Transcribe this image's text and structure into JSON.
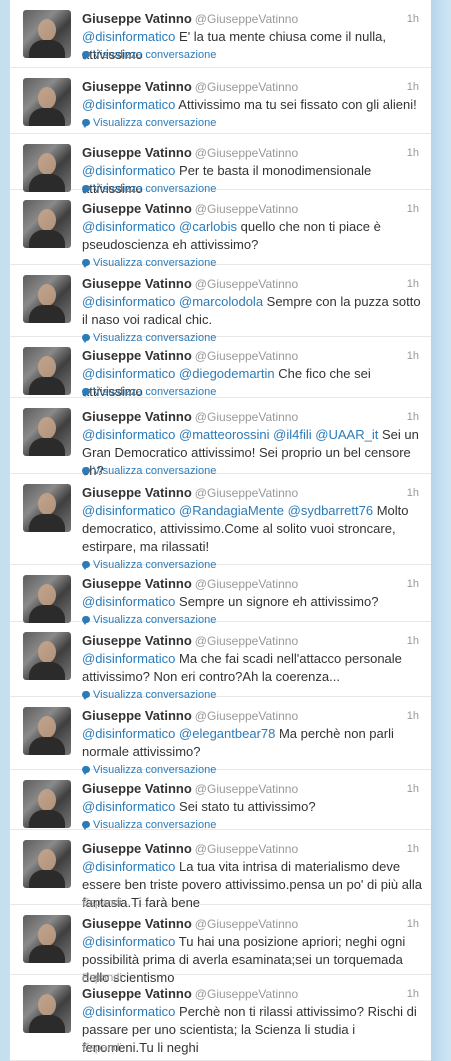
{
  "author": {
    "name": "Giuseppe Vatinno",
    "handle": "@GiuseppeVatinno"
  },
  "tweets": [
    {
      "time": "1h",
      "action": "Visualizza conversazione",
      "segments": [
        {
          "t": "@disinformatico",
          "m": true
        },
        {
          "t": " E' la tua mente chiusa come il nulla, attivissimo",
          "m": false
        }
      ]
    },
    {
      "time": "1h",
      "action": "Visualizza conversazione",
      "segments": [
        {
          "t": "@disinformatico",
          "m": true
        },
        {
          "t": " Attivissimo ma tu sei fissato con gli alieni!",
          "m": false
        }
      ]
    },
    {
      "time": "1h",
      "action": "Visualizza conversazione",
      "segments": [
        {
          "t": "@disinformatico",
          "m": true
        },
        {
          "t": " Per te basta il monodimensionale attivissimo",
          "m": false
        }
      ]
    },
    {
      "time": "1h",
      "action": "Visualizza conversazione",
      "segments": [
        {
          "t": "@disinformatico",
          "m": true
        },
        {
          "t": " ",
          "m": false
        },
        {
          "t": "@carlobis",
          "m": true
        },
        {
          "t": " quello che non ti piace è pseudoscienza eh attivissimo?",
          "m": false
        }
      ]
    },
    {
      "time": "1h",
      "action": "Visualizza conversazione",
      "segments": [
        {
          "t": "@disinformatico",
          "m": true
        },
        {
          "t": " ",
          "m": false
        },
        {
          "t": "@marcolodola",
          "m": true
        },
        {
          "t": " Sempre con la puzza sotto il naso voi radical chic.",
          "m": false
        }
      ]
    },
    {
      "time": "1h",
      "action": "Visualizza conversazione",
      "segments": [
        {
          "t": "@disinformatico",
          "m": true
        },
        {
          "t": " ",
          "m": false
        },
        {
          "t": "@diegodemartin",
          "m": true
        },
        {
          "t": " Che fico che sei attivissimo",
          "m": false
        }
      ]
    },
    {
      "time": "1h",
      "action": "Visualizza conversazione",
      "segments": [
        {
          "t": "@disinformatico",
          "m": true
        },
        {
          "t": " ",
          "m": false
        },
        {
          "t": "@matteorossini",
          "m": true
        },
        {
          "t": " ",
          "m": false
        },
        {
          "t": "@il4fili",
          "m": true
        },
        {
          "t": " ",
          "m": false
        },
        {
          "t": "@UAAR_it",
          "m": true
        },
        {
          "t": " Sei un Gran Democratico attivissimo! Sei proprio un bel censore eh?",
          "m": false
        }
      ]
    },
    {
      "time": "1h",
      "action": "Visualizza conversazione",
      "segments": [
        {
          "t": "@disinformatico",
          "m": true
        },
        {
          "t": " ",
          "m": false
        },
        {
          "t": "@RandagiaMente",
          "m": true
        },
        {
          "t": " ",
          "m": false
        },
        {
          "t": "@sydbarrett76",
          "m": true
        },
        {
          "t": " Molto democratico, attivissimo.Come al solito vuoi stroncare, estirpare, ma rilassati!",
          "m": false
        }
      ]
    },
    {
      "time": "1h",
      "action": "Visualizza conversazione",
      "segments": [
        {
          "t": "@disinformatico",
          "m": true
        },
        {
          "t": " Sempre un signore eh attivissimo?",
          "m": false
        }
      ]
    },
    {
      "time": "1h",
      "action": "Visualizza conversazione",
      "segments": [
        {
          "t": "@disinformatico",
          "m": true
        },
        {
          "t": " Ma che fai scadi nell'attacco personale attivissimo? Non eri contro?Ah la coerenza...",
          "m": false
        }
      ]
    },
    {
      "time": "1h",
      "action": "Visualizza conversazione",
      "segments": [
        {
          "t": "@disinformatico",
          "m": true
        },
        {
          "t": " ",
          "m": false
        },
        {
          "t": "@elegantbear78",
          "m": true
        },
        {
          "t": " Ma perchè non parli normale attivissimo?",
          "m": false
        }
      ]
    },
    {
      "time": "1h",
      "action": "Visualizza conversazione",
      "segments": [
        {
          "t": "@disinformatico",
          "m": true
        },
        {
          "t": " Sei stato tu attivissimo?",
          "m": false
        }
      ]
    },
    {
      "time": "1h",
      "action": "Espandi",
      "segments": [
        {
          "t": "@disinformatico",
          "m": true
        },
        {
          "t": " La tua vita intrisa di materialismo deve essere ben triste povero attivissimo.pensa un po' di più alla fantasia.Ti farà bene",
          "m": false
        }
      ]
    },
    {
      "time": "1h",
      "action": "Espandi",
      "segments": [
        {
          "t": "@disinformatico",
          "m": true
        },
        {
          "t": " Tu hai una posizione apriori; neghi ogni possibilità prima di averla esaminata;sei un torquemada dello scientismo",
          "m": false
        }
      ]
    },
    {
      "time": "1h",
      "action": "Espandi",
      "segments": [
        {
          "t": "@disinformatico",
          "m": true
        },
        {
          "t": " Perchè non ti rilassi attivissimo? Rischi di passare per uno scientista; la Scienza li studia i fenomeni.Tu li neghi",
          "m": false
        }
      ]
    }
  ]
}
